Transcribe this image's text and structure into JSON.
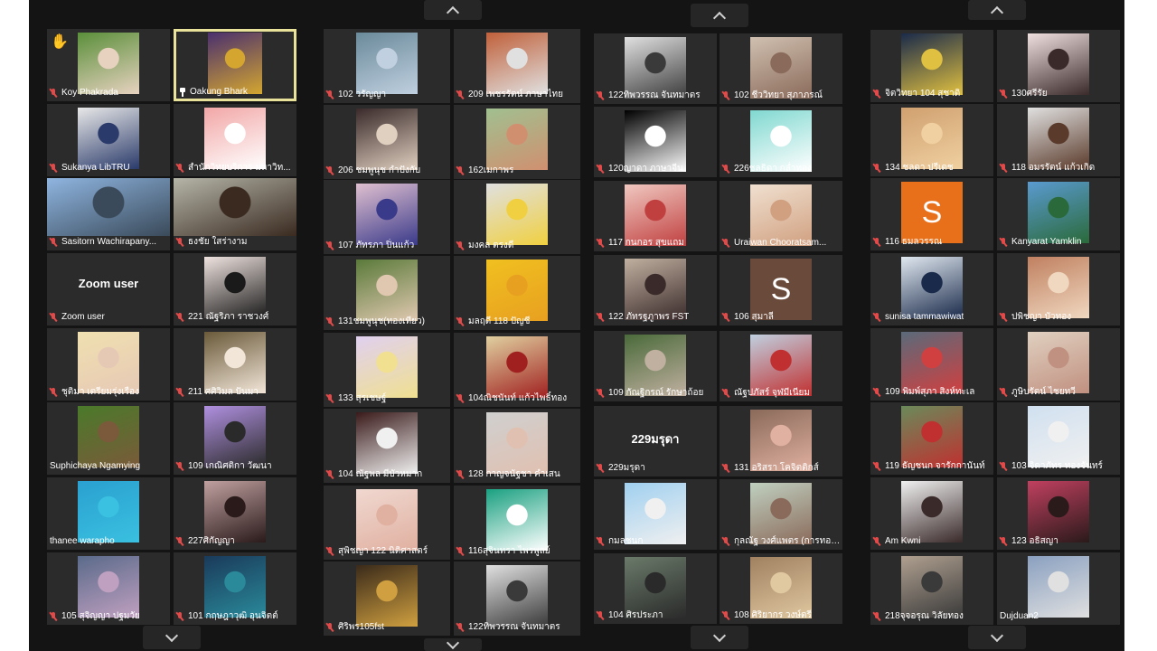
{
  "meeting": {
    "raised_hand_icon": "hand-icon",
    "mute_icon": "muted-mic-icon",
    "pin_icon": "pin-icon",
    "nav_icons": {
      "up": "chevron-up-icon",
      "down": "chevron-down-icon"
    }
  },
  "colors": {
    "background": "#141414",
    "tile": "#2b2b2b",
    "active_border": "#e8e29a",
    "mute": "#e24a4a"
  },
  "participants": [
    {
      "name": "Koy Phakrada",
      "muted": true,
      "hand": true,
      "photo": [
        "#5a8f3a",
        "#e7d2c0"
      ]
    },
    {
      "name": "Oakung Bhark",
      "pinned": true,
      "active": true,
      "photo": [
        "#4a2f6e",
        "#d4a630"
      ]
    },
    {
      "name": "Sukanya LibTRU",
      "muted": true,
      "photo": [
        "#e8e8e8",
        "#2a3a6a"
      ]
    },
    {
      "name": "สำนักวิทยบริการ มหาวิท...",
      "muted": true,
      "photo": [
        "#f2a6a6",
        "#ffffff"
      ]
    },
    {
      "name": "Sasitorn Wachirapany...",
      "muted": true,
      "wide": true,
      "photo": [
        "#8fb5e0",
        "#3a4a5a"
      ]
    },
    {
      "name": "ธงชัย ใสร่างาม",
      "muted": true,
      "wide": true,
      "photo": [
        "#b5b5a8",
        "#3a2a20"
      ]
    },
    {
      "name": "Zoom user",
      "muted": true,
      "big": "Zoom user"
    },
    {
      "name": "221 ณัฐริภา ราชวงศ์",
      "muted": true,
      "photo": [
        "#efe3df",
        "#1a1a1a"
      ]
    },
    {
      "name": "ชุติมา เตรียมรุ่งเรือง",
      "muted": true,
      "photo": [
        "#f0e0b0",
        "#e6c9b5"
      ]
    },
    {
      "name": "211 ศศิวิมล ปันมา",
      "muted": true,
      "photo": [
        "#6a5a3a",
        "#f2e6d8"
      ]
    },
    {
      "name": "Suphichaya Ngamying",
      "muted": false,
      "photo": [
        "#4a7a2a",
        "#7a5a3a"
      ]
    },
    {
      "name": "109 เกณิศติกา วัฒนา",
      "muted": true,
      "photo": [
        "#b090e0",
        "#2a2a2a"
      ]
    },
    {
      "name": "thanee warapho",
      "muted": false,
      "photo": [
        "#2aa0d0",
        "#3ac0e0"
      ]
    },
    {
      "name": "227ศิกัญญา",
      "muted": true,
      "photo": [
        "#c0a0a0",
        "#2a1a1a"
      ]
    },
    {
      "name": "105 สุจิญญา ปฐมวัย",
      "muted": true,
      "photo": [
        "#5a6a8a",
        "#c0a0c0"
      ]
    },
    {
      "name": "101 กฤษฎาวุฒิ อุนจิตต์",
      "muted": true,
      "photo": [
        "#1a3a5a",
        "#2a8a9a"
      ]
    },
    {
      "name": "102 วรัญญา",
      "muted": true,
      "photo": [
        "#6a8a9a",
        "#c0d0e0"
      ]
    },
    {
      "name": "209 เพชรรัตน์ ภาษาไทย",
      "muted": true,
      "photo": [
        "#c0603a",
        "#e0e0e0"
      ]
    },
    {
      "name": "206 ชมพูนุช กำปังกับ",
      "muted": true,
      "photo": [
        "#3a2a2a",
        "#e0d0c0"
      ]
    },
    {
      "name": "162เมกาพร",
      "muted": true,
      "photo": [
        "#a0c090",
        "#d09070"
      ]
    },
    {
      "name": "107 ภัทรภา ปิ่นแก้ว",
      "muted": true,
      "photo": [
        "#e0c0d0",
        "#3a3a8a"
      ]
    },
    {
      "name": "มงคล ตรงดี",
      "muted": true,
      "photo": [
        "#e0e0e0",
        "#f0d040"
      ]
    },
    {
      "name": "131ชมพูนุช(ทองเทียว)",
      "muted": true,
      "photo": [
        "#5a7a3a",
        "#e0c8b0"
      ]
    },
    {
      "name": "มลฤดี 118 ปัญชี",
      "muted": true,
      "photo": [
        "#f0c020",
        "#e8a020"
      ]
    },
    {
      "name": "133 สุรเชษฐ์",
      "muted": true,
      "photo": [
        "#e0d0f0",
        "#f0e090"
      ]
    },
    {
      "name": "104ณิชนันท์ แก้วไพธิ์ทอง",
      "muted": true,
      "photo": [
        "#e0d0a0",
        "#a02020"
      ]
    },
    {
      "name": "104 ณัฐพล มีบัวหมาก",
      "muted": true,
      "photo": [
        "#3a1a1a",
        "#f0f0f0"
      ]
    },
    {
      "name": "128 กาญจนัฐชา คำเสน",
      "muted": true,
      "photo": [
        "#d0d0d0",
        "#e0c0b0"
      ]
    },
    {
      "name": "สุพิชญา 122 นิติศาสตร์",
      "muted": true,
      "photo": [
        "#f0d8d0",
        "#e0b0a0"
      ]
    },
    {
      "name": "116สุจินทรา ไพรพูลย์",
      "muted": true,
      "photo": [
        "#1aa080",
        "#ffffff"
      ]
    },
    {
      "name": "ศิริพร105fst",
      "muted": true,
      "photo": [
        "#3a2a1a",
        "#d0a040"
      ]
    },
    {
      "name": "122ทิพวรรณ จันทมาตร",
      "muted": true,
      "photo": [
        "#e0e0e0",
        "#3a3a3a"
      ]
    },
    {
      "name": "122ทิพวรรณ จันทมาตร",
      "muted": true,
      "photo": [
        "#e0e0e0",
        "#3a3a3a"
      ]
    },
    {
      "name": "102 ชีววิทยา สุภาภรณ์",
      "muted": true,
      "photo": [
        "#d0c0b0",
        "#8a6a5a"
      ]
    },
    {
      "name": "120ญาดา ภาษาจีน",
      "muted": true,
      "photo": [
        "#000000",
        "#ffffff"
      ]
    },
    {
      "name": "226ชลธิดา กล่ำทอง",
      "muted": true,
      "photo": [
        "#80d8d0",
        "#ffffff"
      ]
    },
    {
      "name": "117 กนกอร สุขแถม",
      "muted": true,
      "photo": [
        "#f0c8c0",
        "#c04040"
      ]
    },
    {
      "name": "Uraiwan Chooratsam...",
      "muted": true,
      "photo": [
        "#f0e0d0",
        "#d0a080"
      ]
    },
    {
      "name": "122 ภัทรฐภูาพร FST",
      "muted": true,
      "photo": [
        "#c0b0a0",
        "#3a2a2a"
      ]
    },
    {
      "name": "106 สุมาลี",
      "muted": true,
      "letter": "S",
      "photo": [
        "#6a4a3a",
        "#6a4a3a"
      ]
    },
    {
      "name": "109 กัณฐิกรณ์ รักษาถ้อย",
      "muted": true,
      "photo": [
        "#4a6a3a",
        "#c0b0a0"
      ]
    },
    {
      "name": "ณัฐปภัสร์ จุฬมีเนียม",
      "muted": true,
      "photo": [
        "#c0d0e0",
        "#c03030"
      ]
    },
    {
      "name": "229มรุดา",
      "muted": true,
      "big": "229มรุดา"
    },
    {
      "name": "131 อริสรา โคจิตติกส์",
      "muted": true,
      "photo": [
        "#8a6a5a",
        "#e0b0a0"
      ]
    },
    {
      "name": "กมลชนก",
      "muted": true,
      "photo": [
        "#a0d0f0",
        "#f0f0f0"
      ]
    },
    {
      "name": "กุลณัฐ วงศ์แพตร (การทอง...",
      "muted": true,
      "photo": [
        "#c0d0c0",
        "#8a6a5a"
      ]
    },
    {
      "name": "104 ศิรประภา",
      "muted": true,
      "photo": [
        "#6a7a6a",
        "#2a2a2a"
      ]
    },
    {
      "name": "108 ศิริยากร วงษ์ตรี",
      "muted": true,
      "photo": [
        "#a08060",
        "#e0c8a0"
      ]
    },
    {
      "name": "จิตวิทยา 104 สุชาติ",
      "muted": true,
      "photo": [
        "#1a2a4a",
        "#e0c040"
      ]
    },
    {
      "name": "130ศรีรัย",
      "muted": true,
      "photo": [
        "#f0e0e0",
        "#3a2a2a"
      ]
    },
    {
      "name": "134 ชลดา ปรีเดช",
      "muted": true,
      "photo": [
        "#d0a070",
        "#f0d0a0"
      ]
    },
    {
      "name": "118 อมรรัตน์ แก้วเกิด",
      "muted": true,
      "photo": [
        "#e0e0e0",
        "#5a3a2a"
      ]
    },
    {
      "name": "116 ธมลวรรณ",
      "muted": true,
      "letter": "S",
      "photo": [
        "#e8701a",
        "#e8701a"
      ]
    },
    {
      "name": "Kanyarat Yamklin",
      "muted": true,
      "photo": [
        "#5a9ad0",
        "#2a6a3a"
      ]
    },
    {
      "name": "sunisa tammawiwat",
      "muted": true,
      "photo": [
        "#e0e8f0",
        "#1a2a4a"
      ]
    },
    {
      "name": "ปพิชญา บัวทอง",
      "muted": true,
      "photo": [
        "#c08060",
        "#f0d8c0"
      ]
    },
    {
      "name": "109 พิมพ์สุภา สิงห์ทะเล",
      "muted": true,
      "photo": [
        "#5a6a7a",
        "#d04040"
      ]
    },
    {
      "name": "ภูษิบรัตน์ ไชยทวี",
      "muted": true,
      "photo": [
        "#e0d0c0",
        "#c09080"
      ]
    },
    {
      "name": "119 ธัญชนก จารักกานันท์",
      "muted": true,
      "photo": [
        "#6a8a5a",
        "#c03030"
      ]
    },
    {
      "name": "103 จิดาภัทร ทองจันทร์",
      "muted": true,
      "photo": [
        "#d0e0f0",
        "#f0f0f0"
      ]
    },
    {
      "name": "Am Kwni",
      "muted": true,
      "photo": [
        "#f0f0f0",
        "#3a2a2a"
      ]
    },
    {
      "name": "123 อธิสญา",
      "muted": true,
      "photo": [
        "#c04060",
        "#2a1a1a"
      ]
    },
    {
      "name": "218จุจอรุณ วิลัยทอง",
      "muted": true,
      "photo": [
        "#b0a090",
        "#3a3a3a"
      ]
    },
    {
      "name": "Dujduan2",
      "muted": false,
      "photo": [
        "#8aa0c0",
        "#e0e0e0"
      ]
    }
  ]
}
